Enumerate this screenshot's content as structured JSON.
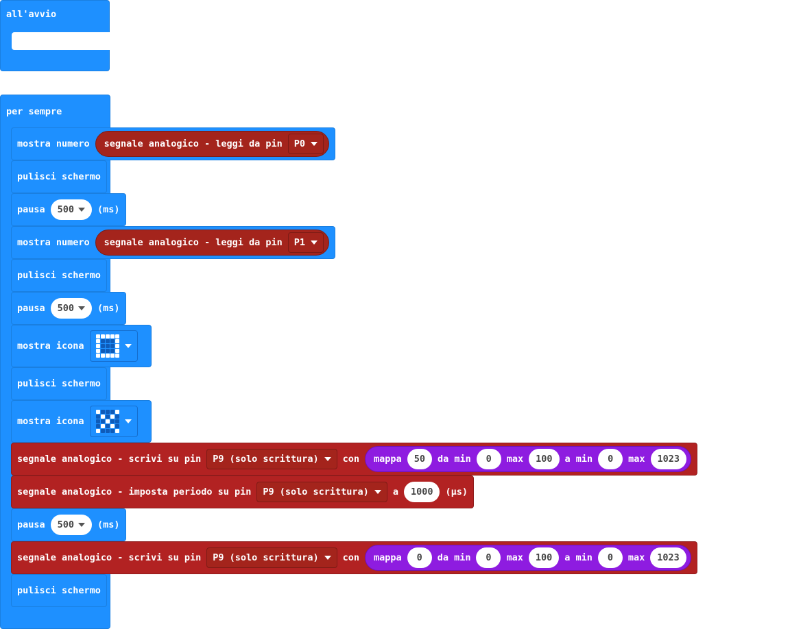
{
  "on_start": {
    "label": "all'avvio"
  },
  "forever": {
    "label": "per sempre",
    "show_number": "mostra numero",
    "analog_read": "segnale analogico - leggi da pin",
    "pin_p0": "P0",
    "pin_p1": "P1",
    "clear_screen": "pulisci schermo",
    "pause": "pausa",
    "pause_value": "500",
    "ms": "(ms)",
    "show_icon": "mostra icona",
    "analog_write": "segnale analogico - scrivi su pin",
    "pin_p9": "P9 (solo scrittura)",
    "with": "con",
    "map": "mappa",
    "from_min": "da min",
    "max": "max",
    "to_min": "a min",
    "map1": {
      "value": "50",
      "from_low": "0",
      "from_high": "100",
      "to_low": "0",
      "to_high": "1023"
    },
    "map2": {
      "value": "0",
      "from_low": "0",
      "from_high": "100",
      "to_low": "0",
      "to_high": "1023"
    },
    "set_period": "segnale analogico - imposta periodo su pin",
    "a": "a",
    "period_value": "1000",
    "us": "(µs)"
  },
  "icons": {
    "square": [
      1,
      1,
      1,
      1,
      1,
      1,
      0,
      0,
      0,
      1,
      1,
      0,
      0,
      0,
      1,
      1,
      0,
      0,
      0,
      1,
      1,
      1,
      1,
      1,
      1
    ],
    "x": [
      1,
      0,
      0,
      0,
      1,
      0,
      1,
      0,
      1,
      0,
      0,
      0,
      1,
      0,
      0,
      0,
      1,
      0,
      1,
      0,
      1,
      0,
      0,
      0,
      1
    ]
  },
  "colors": {
    "basic": "#1e90ff",
    "pins": "#b22222",
    "math_map": "#8e1ce0"
  }
}
